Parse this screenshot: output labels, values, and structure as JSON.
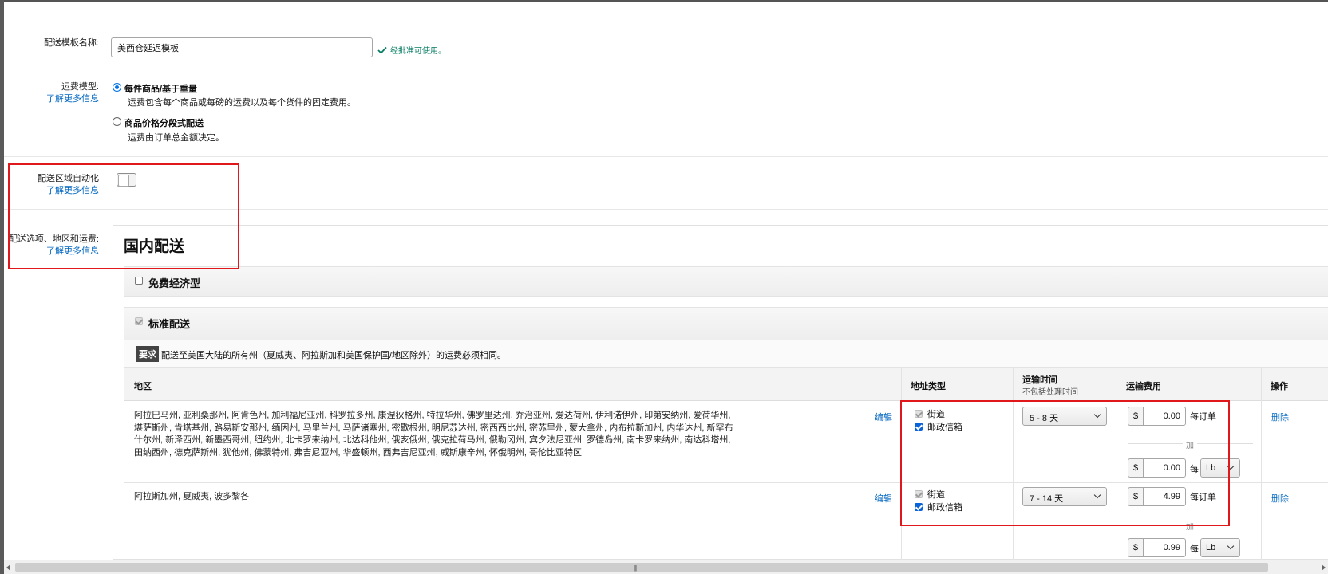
{
  "template_name": {
    "label": "配送模板名称:",
    "value": "美西仓延迟模板",
    "status": "经批准可使用。"
  },
  "shipping_model": {
    "label": "运费模型:",
    "learn_more": "了解更多信息",
    "options": [
      {
        "title": "每件商品/基于重量",
        "desc": "运费包含每个商品或每磅的运费以及每个货件的固定费用。",
        "selected": true
      },
      {
        "title": "商品价格分段式配送",
        "desc": "运费由订单总金额决定。",
        "selected": false
      }
    ]
  },
  "automation": {
    "label": "配送区域自动化",
    "learn_more": "了解更多信息",
    "enabled": false
  },
  "options_section": {
    "label": "配送选项、地区和运费:",
    "learn_more": "了解更多信息",
    "heading": "国内配送"
  },
  "free_economy": {
    "label": "免费经济型",
    "checked": false
  },
  "standard": {
    "label": "标准配送",
    "checked": true
  },
  "requirement": {
    "badge": "要求",
    "text": "配送至美国大陆的所有州（夏威夷、阿拉斯加和美国保护国/地区除外）的运费必须相同。"
  },
  "table": {
    "headers": {
      "region": "地区",
      "address_type": "地址类型",
      "transit": "运输时间",
      "transit_sub": "不包括处理时间",
      "fee": "运输费用",
      "action": "操作"
    },
    "rows": [
      {
        "region": "阿拉巴马州, 亚利桑那州, 阿肯色州, 加利福尼亚州, 科罗拉多州, 康涅狄格州, 特拉华州, 佛罗里达州, 乔治亚州, 爱达荷州, 伊利诺伊州, 印第安纳州, 爱荷华州, 堪萨斯州, 肯塔基州, 路易斯安那州, 缅因州, 马里兰州, 马萨诸塞州, 密歇根州, 明尼苏达州, 密西西比州, 密苏里州, 蒙大拿州, 内布拉斯加州, 内华达州, 新罕布什尔州, 新泽西州, 新墨西哥州, 纽约州, 北卡罗来纳州, 北达科他州, 俄亥俄州, 俄克拉荷马州, 俄勒冈州, 宾夕法尼亚州, 罗德岛州, 南卡罗来纳州, 南达科塔州, 田纳西州, 德克萨斯州, 犹他州, 佛蒙特州, 弗吉尼亚州, 华盛顿州, 西弗吉尼亚州, 威斯康辛州, 怀俄明州, 哥伦比亚特区",
        "edit": "编辑",
        "street": "街道",
        "po_box": "邮政信箱",
        "transit": "5 - 8 天",
        "per_order_currency": "$",
        "per_order": "0.00",
        "per_order_label": "每订单",
        "plus": "加",
        "per_unit_currency": "$",
        "per_unit": "0.00",
        "per_label": "每",
        "unit": "Lb",
        "delete": "删除"
      },
      {
        "region": "阿拉斯加州, 夏威夷, 波多黎各",
        "edit": "编辑",
        "street": "街道",
        "po_box": "邮政信箱",
        "transit": "7 - 14 天",
        "per_order_currency": "$",
        "per_order": "4.99",
        "per_order_label": "每订单",
        "plus": "加",
        "per_unit_currency": "$",
        "per_unit": "0.99",
        "per_label": "每",
        "unit": "Lb",
        "delete": "删除"
      }
    ]
  },
  "colors": {
    "link": "#0066c0",
    "highlight": "#e0181b",
    "ok": "#067d62"
  }
}
